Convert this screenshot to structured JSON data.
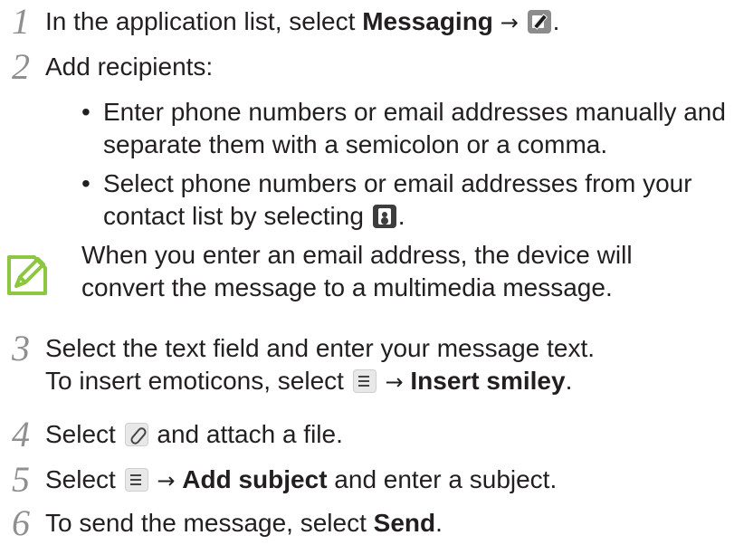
{
  "steps": [
    {
      "num": "1",
      "pre": "In the application list, select ",
      "bold": "Messaging",
      "arrow": "→",
      "end": "."
    },
    {
      "num": "2",
      "text": "Add recipients:"
    },
    {
      "num": "3",
      "line1": "Select the text field and enter your message text.",
      "line2_pre": "To insert emoticons, select",
      "line2_arrow": "→",
      "line2_bold": "Insert smiley",
      "line2_end": "."
    },
    {
      "num": "4",
      "pre": "Select",
      "post": "and attach a file."
    },
    {
      "num": "5",
      "pre": "Select",
      "arrow": "→",
      "bold": "Add subject",
      "post": " and enter a subject."
    },
    {
      "num": "6",
      "pre": "To send the message, select ",
      "bold": "Send",
      "end": "."
    }
  ],
  "bullets": [
    {
      "dot": "•",
      "line1": "Enter phone numbers or email addresses manually and",
      "line2": "separate them with a semicolon or a comma."
    },
    {
      "dot": "•",
      "line1": "Select phone numbers or email addresses from your",
      "line2_pre": "contact list by selecting",
      "line2_end": "."
    }
  ],
  "note": {
    "line1": "When you enter an email address, the device will",
    "line2": "convert the message to a multimedia message."
  },
  "colors": {
    "text": "#231f20",
    "step_number": "#8f8f90",
    "note_icon": "#8dc63f"
  },
  "icons": [
    "compose-icon",
    "contacts-icon",
    "menu-icon",
    "attach-icon",
    "note-icon"
  ]
}
